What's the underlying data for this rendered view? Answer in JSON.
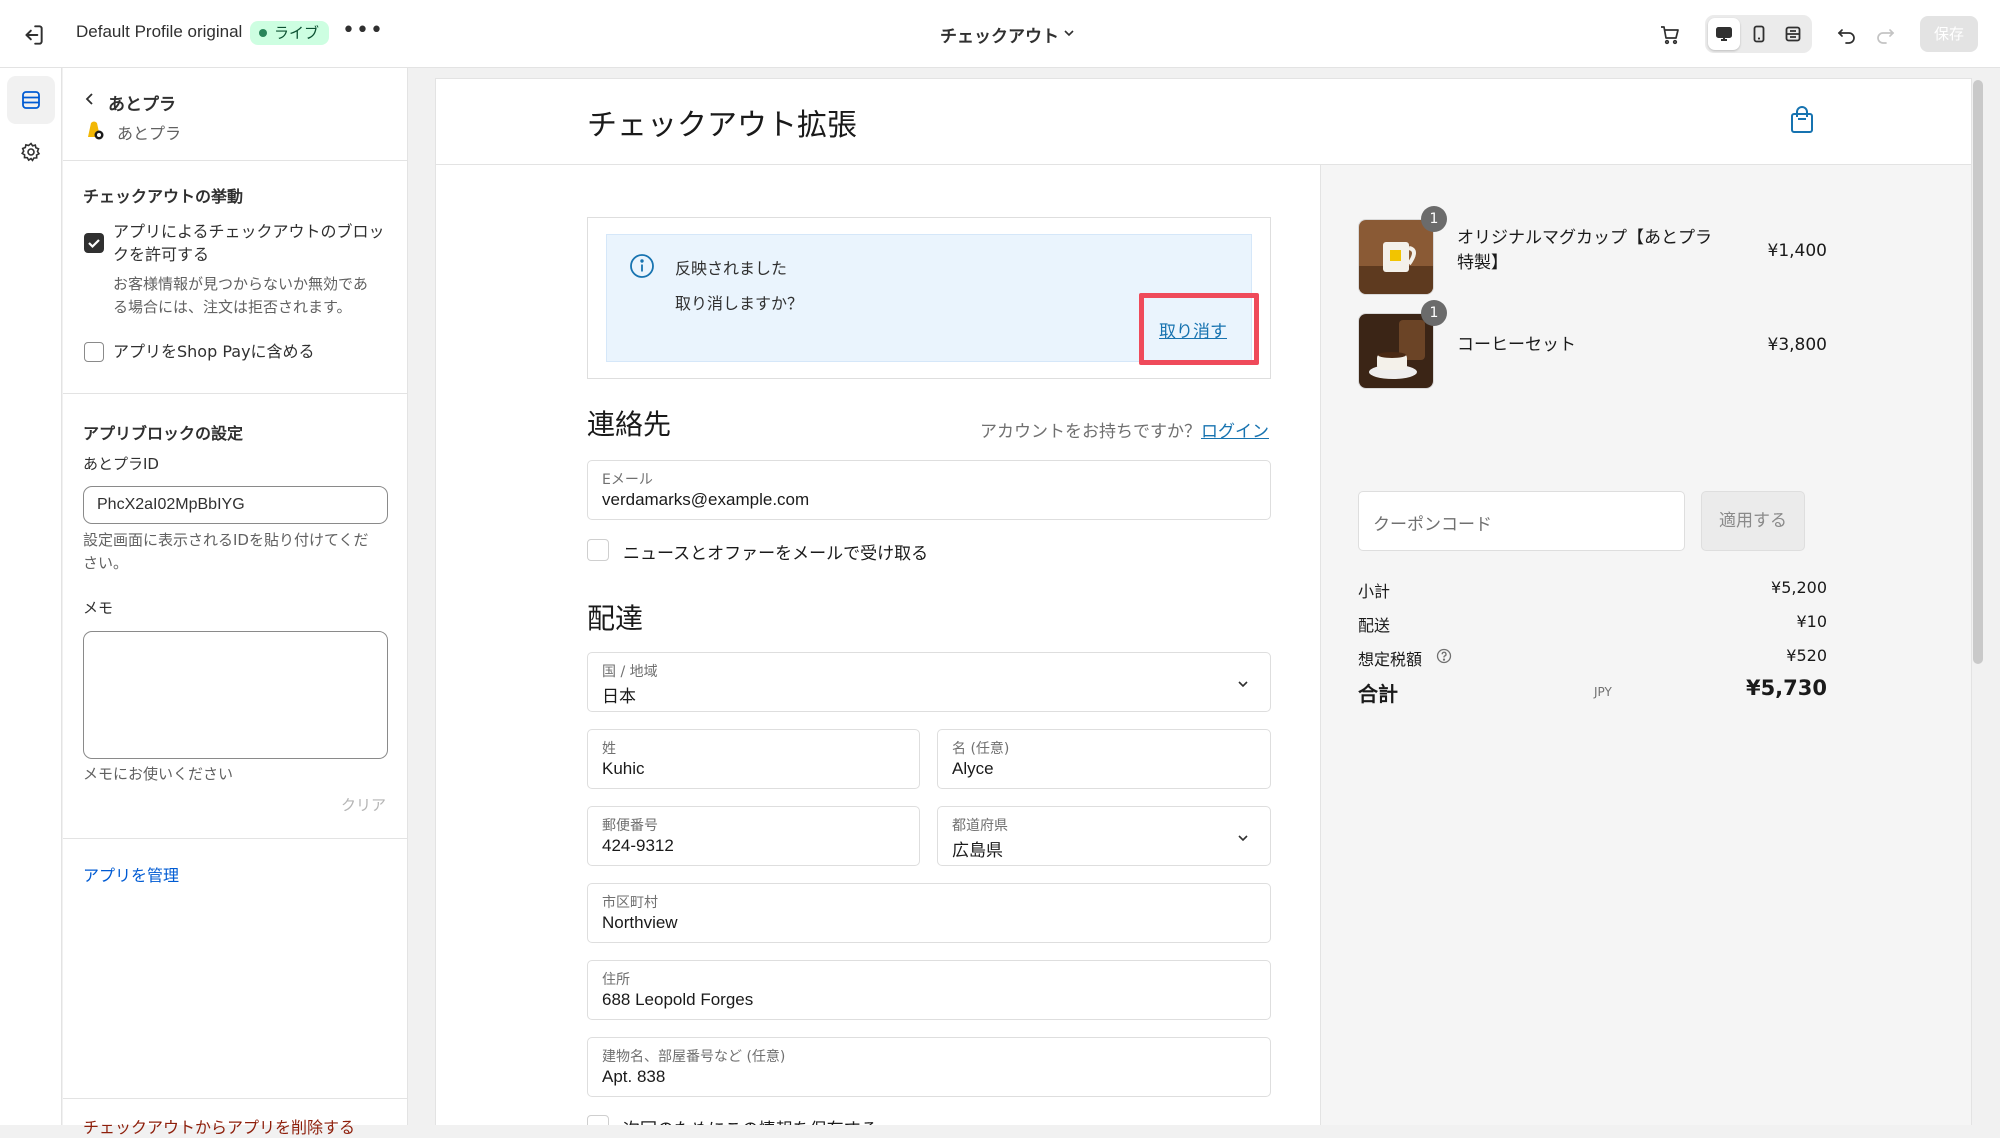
{
  "topbar": {
    "profile_name": "Default Profile original",
    "status_badge": "ライブ",
    "more": "•••",
    "page_selector": "チェックアウト",
    "save_label": "保存"
  },
  "panel": {
    "back_title": "あとプラ",
    "app_subtitle": "あとプラ",
    "behavior_heading": "チェックアウトの挙動",
    "allow_block_label_1": "アプリによるチェックアウトのブロッ",
    "allow_block_label_2": "クを許可する",
    "allow_block_help_1": "お客様情報が見つからないか無効であ",
    "allow_block_help_2": "る場合には、注文は拒否されます。",
    "allow_block_checked": true,
    "shoppay_label": "アプリをShop Payに含める",
    "shoppay_checked": false,
    "settings_heading": "アプリブロックの設定",
    "id_label": "あとプラID",
    "id_value": "PhcX2aI02MpBbIYG",
    "id_help_1": "設定画面に表示されるIDを貼り付けてくだ",
    "id_help_2": "さい。",
    "memo_label": "メモ",
    "memo_value": "",
    "memo_help": "メモにお使いください",
    "clear_label": "クリア",
    "manage_link": "アプリを管理",
    "remove_link": "チェックアウトからアプリを削除する"
  },
  "preview": {
    "store_title": "チェックアウト拡張",
    "banner": {
      "line1": "反映されました",
      "line2": "取り消しますか？",
      "undo_link": "取り消す"
    },
    "contact": {
      "heading": "連絡先",
      "account_prompt": "アカウントをお持ちですか？",
      "login_link": "ログイン",
      "email_label": "Eメール",
      "email_value": "verdamarks@example.com",
      "newsletter_label": "ニュースとオファーをメールで受け取る"
    },
    "delivery": {
      "heading": "配達",
      "country_label": "国 / 地域",
      "country_value": "日本",
      "last_name_label": "姓",
      "last_name_value": "Kuhic",
      "first_name_label": "名 (任意)",
      "first_name_value": "Alyce",
      "postal_label": "郵便番号",
      "postal_value": "424-9312",
      "prefecture_label": "都道府県",
      "prefecture_value": "広島県",
      "city_label": "市区町村",
      "city_value": "Northview",
      "address_label": "住所",
      "address_value": "688 Leopold Forges",
      "building_label": "建物名、部屋番号など (任意)",
      "building_value": "Apt. 838",
      "save_info_label": "次回のためにこの情報を保存する"
    },
    "summary": {
      "items": [
        {
          "qty": "1",
          "name_1": "オリジナルマグカップ【あとプラ",
          "name_2": "特製】",
          "price": "¥1,400"
        },
        {
          "qty": "1",
          "name_1": "コーヒーセット",
          "name_2": "",
          "price": "¥3,800"
        }
      ],
      "coupon_placeholder": "クーポンコード",
      "apply_label": "適用する",
      "subtotal_label": "小計",
      "subtotal_value": "¥5,200",
      "shipping_label": "配送",
      "shipping_value": "¥10",
      "tax_label": "想定税額",
      "tax_value": "¥520",
      "total_label": "合計",
      "total_currency": "JPY",
      "total_value": "¥5,730"
    }
  },
  "colors": {
    "link": "#1773b0",
    "admin_link": "#005bd3",
    "highlight_box": "#ef4a5a",
    "banner_bg": "#eaf4fd",
    "badge_bg": "#cdfee1"
  }
}
